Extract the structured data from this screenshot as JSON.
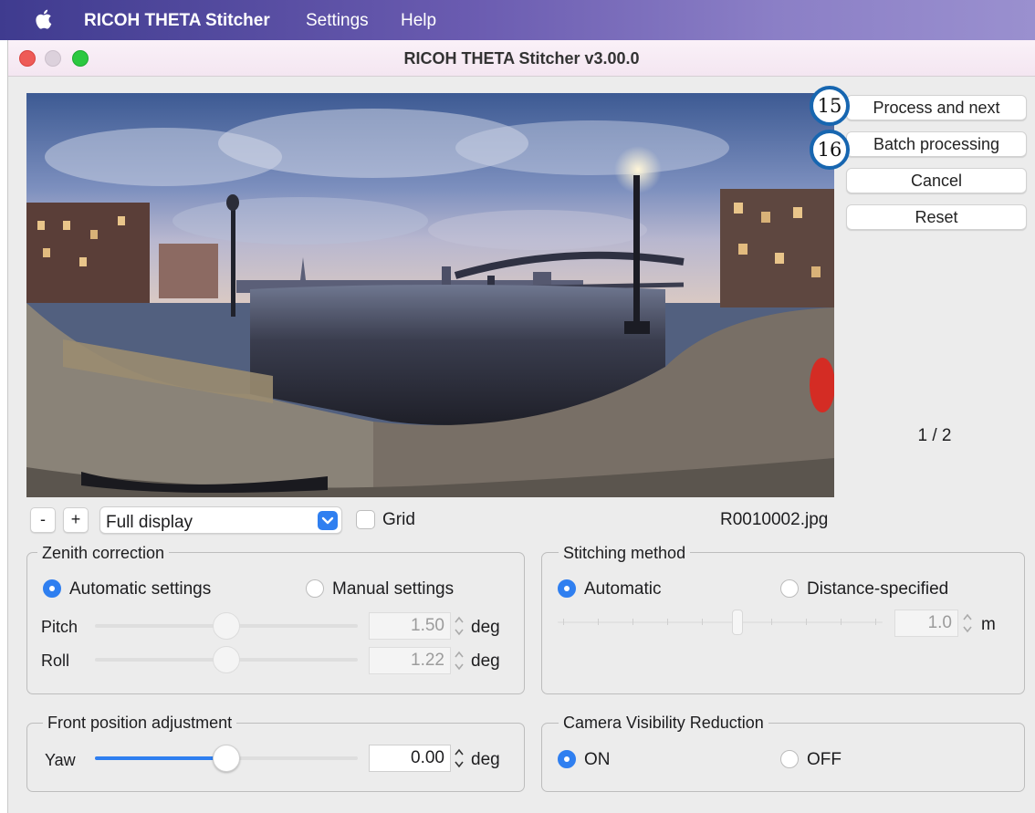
{
  "menubar": {
    "app_name": "RICOH THETA Stitcher",
    "menu_settings": "Settings",
    "menu_help": "Help"
  },
  "window": {
    "title": "RICOH THETA Stitcher v3.00.0"
  },
  "actions": {
    "process_next": "Process and next",
    "batch": "Batch processing",
    "cancel": "Cancel",
    "reset": "Reset",
    "badge_process": "15",
    "badge_batch": "16"
  },
  "viewer": {
    "counter": "1 / 2",
    "zoom_out": "-",
    "zoom_in": "+",
    "display_mode": "Full display",
    "grid_label": "Grid",
    "grid_checked": false,
    "filename": "R0010002.jpg"
  },
  "zenith": {
    "title": "Zenith correction",
    "auto_label": "Automatic settings",
    "manual_label": "Manual settings",
    "selected": "auto",
    "pitch_label": "Pitch",
    "pitch_value": "1.50",
    "roll_label": "Roll",
    "roll_value": "1.22",
    "unit": "deg"
  },
  "stitching": {
    "title": "Stitching method",
    "auto_label": "Automatic",
    "distance_label": "Distance-specified",
    "selected": "auto",
    "distance_value": "1.0",
    "unit": "m"
  },
  "front": {
    "title": "Front position adjustment",
    "yaw_label": "Yaw",
    "yaw_value": "0.00",
    "unit": "deg"
  },
  "camera_visibility": {
    "title": "Camera Visibility Reduction",
    "on_label": "ON",
    "off_label": "OFF",
    "selected": "on"
  },
  "colors": {
    "accent": "#2f7ff0",
    "badge_ring": "#1766b0",
    "menubar_start": "#3f3b8f",
    "close": "#ee5b57",
    "zoom": "#2bc840"
  }
}
